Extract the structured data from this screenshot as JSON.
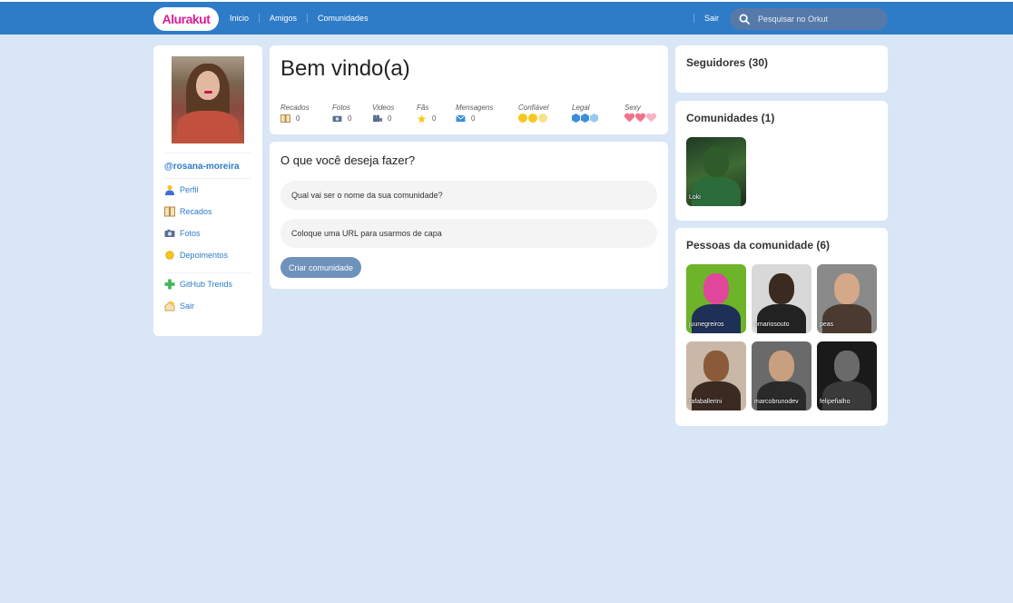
{
  "header": {
    "logo": "Alurakut",
    "nav": [
      "Inicio",
      "Amigos",
      "Comunidades"
    ],
    "logout": "Sair",
    "search_placeholder": "Pesquisar no Orkut"
  },
  "sidebar": {
    "username": "@rosana-moreira",
    "items": [
      {
        "label": "Perfil",
        "icon": "user-icon"
      },
      {
        "label": "Recados",
        "icon": "book-icon"
      },
      {
        "label": "Fotos",
        "icon": "camera-icon"
      },
      {
        "label": "Depoimentos",
        "icon": "sun-icon"
      }
    ],
    "items2": [
      {
        "label": "GitHub Trends",
        "icon": "plus-icon"
      },
      {
        "label": "Sair",
        "icon": "logout-icon"
      }
    ]
  },
  "welcome": {
    "title": "Bem vindo(a)",
    "stats": [
      {
        "label": "Recados",
        "value": "0"
      },
      {
        "label": "Fotos",
        "value": "0"
      },
      {
        "label": "Videos",
        "value": "0"
      },
      {
        "label": "Fãs",
        "value": "0"
      },
      {
        "label": "Mensagens",
        "value": "0"
      }
    ],
    "ratings": [
      {
        "label": "Confiável",
        "icon": "smile-icon",
        "level": 2,
        "max": 3
      },
      {
        "label": "Legal",
        "icon": "cube-icon",
        "level": 2,
        "max": 3
      },
      {
        "label": "Sexy",
        "icon": "heart-icon",
        "level": 2,
        "max": 3
      }
    ]
  },
  "form": {
    "title": "O que você deseja fazer?",
    "name_placeholder": "Qual vai ser o nome da sua comunidade?",
    "url_placeholder": "Coloque uma URL para usarmos de capa",
    "submit": "Criar comunidade"
  },
  "right": {
    "followers_title": "Seguidores (30)",
    "communities_title": "Comunidades (1)",
    "communities": [
      {
        "name": "Loki"
      }
    ],
    "people_title": "Pessoas da comunidade (6)",
    "people": [
      {
        "name": "juunegreiros"
      },
      {
        "name": "omariosouto"
      },
      {
        "name": "peas"
      },
      {
        "name": "rafaballerini"
      },
      {
        "name": "marcobrunodev"
      },
      {
        "name": "felipefialho"
      }
    ]
  }
}
